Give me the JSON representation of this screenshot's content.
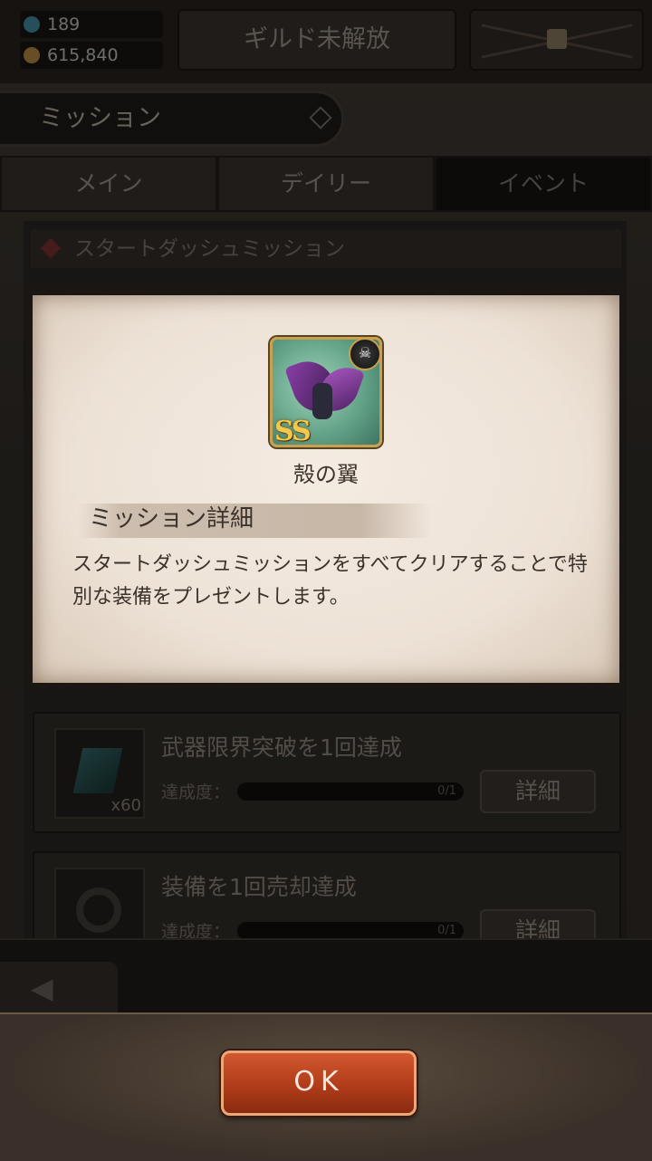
{
  "status": {
    "gems": "189",
    "gold": "615,840"
  },
  "header": {
    "guild_button": "ギルド未解放",
    "mission_title": "ミッション"
  },
  "tabs": [
    {
      "label": "メイン"
    },
    {
      "label": "デイリー"
    },
    {
      "label": "イベント"
    }
  ],
  "section": {
    "title": "スタートダッシュミッション"
  },
  "missions": [
    {
      "title": "武器限界突破を1回達成",
      "progress_label": "達成度：",
      "progress_value": "0/1",
      "progress_fraction": 0,
      "reward_qty": "x60",
      "detail_label": "詳細"
    },
    {
      "title": "装備を1回売却達成",
      "progress_label": "達成度：",
      "progress_value": "0/1",
      "progress_fraction": 0,
      "detail_label": "詳細"
    }
  ],
  "dialog": {
    "item_rank": "SS",
    "item_name": "殻の翼",
    "detail_heading": "ミッション詳細",
    "description": "スタートダッシュミッションをすべてクリアすることで特別な装備をプレゼントします。",
    "ok_label": "OK"
  },
  "colors": {
    "ok_button": "#b03c1a",
    "parchment": "#ede2d6",
    "rank_gold": "#f2c94c"
  }
}
